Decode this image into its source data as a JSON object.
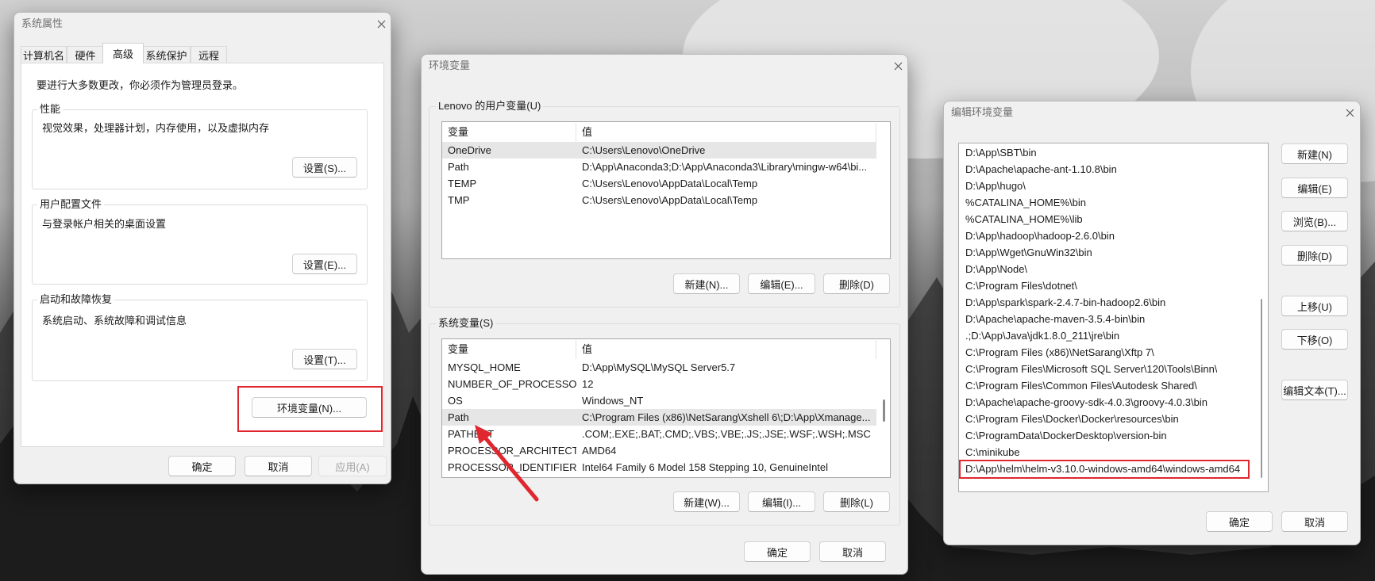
{
  "colors": {
    "annotation_red": "#e0262e",
    "selected_row": "#e6e6e6",
    "dialog_bg": "#f0f0f0"
  },
  "system_properties": {
    "title": "系统属性",
    "tabs": [
      {
        "label": "计算机名"
      },
      {
        "label": "硬件"
      },
      {
        "label": "高级",
        "selected": true
      },
      {
        "label": "系统保护"
      },
      {
        "label": "远程"
      }
    ],
    "notice": "要进行大多数更改，你必须作为管理员登录。",
    "performance": {
      "label": "性能",
      "description": "视觉效果，处理器计划，内存使用，以及虚拟内存",
      "button": "设置(S)..."
    },
    "user_profiles": {
      "label": "用户配置文件",
      "description": "与登录帐户相关的桌面设置",
      "button": "设置(E)..."
    },
    "startup_recovery": {
      "label": "启动和故障恢复",
      "description": "系统启动、系统故障和调试信息",
      "button": "设置(T)..."
    },
    "env_button": "环境变量(N)...",
    "ok": "确定",
    "cancel": "取消",
    "apply": "应用(A)"
  },
  "environment_variables": {
    "title": "环境变量",
    "user_group_label": "Lenovo 的用户变量(U)",
    "columns": {
      "name": "变量",
      "value": "值"
    },
    "user_vars": [
      {
        "name": "OneDrive",
        "value": "C:\\Users\\Lenovo\\OneDrive",
        "selected": true
      },
      {
        "name": "Path",
        "value": "D:\\App\\Anaconda3;D:\\App\\Anaconda3\\Library\\mingw-w64\\bi..."
      },
      {
        "name": "TEMP",
        "value": "C:\\Users\\Lenovo\\AppData\\Local\\Temp"
      },
      {
        "name": "TMP",
        "value": "C:\\Users\\Lenovo\\AppData\\Local\\Temp"
      }
    ],
    "user_buttons": {
      "new": "新建(N)...",
      "edit": "编辑(E)...",
      "delete": "删除(D)"
    },
    "system_group_label": "系统变量(S)",
    "system_vars": [
      {
        "name": "MYSQL_HOME",
        "value": "D:\\App\\MySQL\\MySQL Server5.7"
      },
      {
        "name": "NUMBER_OF_PROCESSORS",
        "value": "12"
      },
      {
        "name": "OS",
        "value": "Windows_NT"
      },
      {
        "name": "Path",
        "value": "C:\\Program Files (x86)\\NetSarang\\Xshell 6\\;D:\\App\\Xmanage...",
        "selected": true
      },
      {
        "name": "PATHEXT",
        "value": ".COM;.EXE;.BAT;.CMD;.VBS;.VBE;.JS;.JSE;.WSF;.WSH;.MSC"
      },
      {
        "name": "PROCESSOR_ARCHITECT...",
        "value": "AMD64"
      },
      {
        "name": "PROCESSOR_IDENTIFIER",
        "value": "Intel64 Family 6 Model 158 Stepping 10, GenuineIntel"
      }
    ],
    "system_buttons": {
      "new": "新建(W)...",
      "edit": "编辑(I)...",
      "delete": "删除(L)"
    },
    "ok": "确定",
    "cancel": "取消"
  },
  "edit_environment_variable": {
    "title": "编辑环境变量",
    "entries": [
      {
        "path": "D:\\App\\SBT\\bin"
      },
      {
        "path": "D:\\Apache\\apache-ant-1.10.8\\bin"
      },
      {
        "path": "D:\\App\\hugo\\"
      },
      {
        "path": "%CATALINA_HOME%\\bin"
      },
      {
        "path": "%CATALINA_HOME%\\lib"
      },
      {
        "path": "D:\\App\\hadoop\\hadoop-2.6.0\\bin"
      },
      {
        "path": "D:\\App\\Wget\\GnuWin32\\bin"
      },
      {
        "path": "D:\\App\\Node\\"
      },
      {
        "path": "C:\\Program Files\\dotnet\\"
      },
      {
        "path": "D:\\App\\spark\\spark-2.4.7-bin-hadoop2.6\\bin"
      },
      {
        "path": "D:\\Apache\\apache-maven-3.5.4-bin\\bin"
      },
      {
        "path": ".;D:\\App\\Java\\jdk1.8.0_211\\jre\\bin"
      },
      {
        "path": "C:\\Program Files (x86)\\NetSarang\\Xftp 7\\"
      },
      {
        "path": "C:\\Program Files\\Microsoft SQL Server\\120\\Tools\\Binn\\"
      },
      {
        "path": "C:\\Program Files\\Common Files\\Autodesk Shared\\"
      },
      {
        "path": "D:\\Apache\\apache-groovy-sdk-4.0.3\\groovy-4.0.3\\bin"
      },
      {
        "path": "C:\\Program Files\\Docker\\Docker\\resources\\bin"
      },
      {
        "path": "C:\\ProgramData\\DockerDesktop\\version-bin"
      },
      {
        "path": "C:\\minikube"
      },
      {
        "path": "D:\\App\\helm\\helm-v3.10.0-windows-amd64\\windows-amd64",
        "highlighted": true
      }
    ],
    "buttons": {
      "new": "新建(N)",
      "edit": "编辑(E)",
      "browse": "浏览(B)...",
      "delete": "删除(D)",
      "move_up": "上移(U)",
      "move_down": "下移(O)",
      "edit_text": "编辑文本(T)..."
    },
    "ok": "确定",
    "cancel": "取消"
  }
}
